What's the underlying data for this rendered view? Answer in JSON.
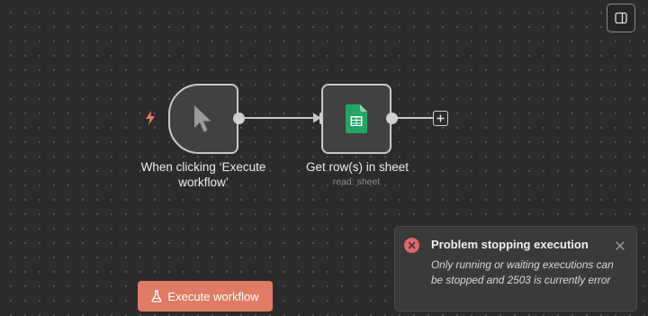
{
  "canvas": {
    "nodes": [
      {
        "id": "trigger",
        "icon": "cursor-pointer-icon",
        "label": "When clicking ‘Execute workflow’",
        "subtitle": ""
      },
      {
        "id": "sheet",
        "icon": "google-sheets-icon",
        "label": "Get row(s) in sheet",
        "subtitle": "read: sheet"
      }
    ],
    "add_node_icon": "plus-icon",
    "trigger_marker_icon": "lightning-bolt-icon"
  },
  "toolbar": {
    "execute_label": "Execute workflow",
    "execute_icon": "flask-icon",
    "panel_toggle_icon": "sidebar-panel-icon"
  },
  "toast": {
    "title": "Problem stopping execution",
    "message": "Only running or waiting executions can be stopped and 2503 is currently error",
    "icon": "error-circle-icon",
    "close_icon": "close-icon"
  },
  "colors": {
    "accent": "#e07a64",
    "error": "#e0656a",
    "sheets_green": "#23a566",
    "canvas_bg": "#2b2b2b"
  }
}
